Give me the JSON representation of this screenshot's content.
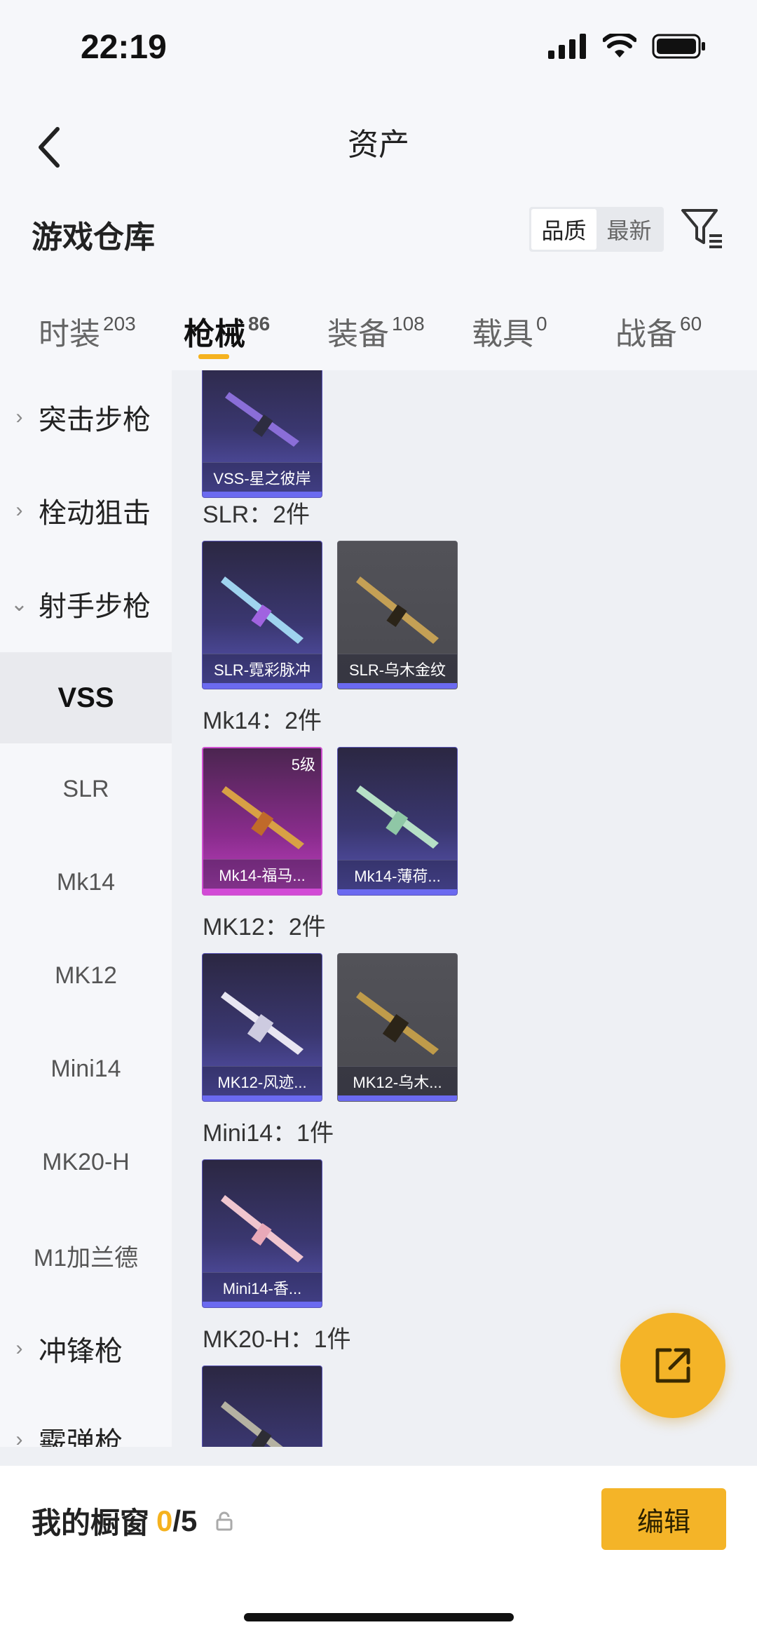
{
  "status": {
    "time": "22:19"
  },
  "nav": {
    "title": "资产"
  },
  "header": {
    "title": "游戏仓库",
    "sort_quality": "品质",
    "sort_latest": "最新"
  },
  "tabs": [
    {
      "label": "时装",
      "count": "203"
    },
    {
      "label": "枪械",
      "count": "86"
    },
    {
      "label": "装备",
      "count": "108"
    },
    {
      "label": "载具",
      "count": "0"
    },
    {
      "label": "战备",
      "count": "60"
    }
  ],
  "sidebar": {
    "cat_assault": "突击步枪",
    "cat_bolt": "栓动狙击",
    "cat_marksman": "射手步枪",
    "sub_vss": "VSS",
    "sub_slr": "SLR",
    "sub_mk14": "Mk14",
    "sub_mk12": "MK12",
    "sub_mini14": "Mini14",
    "sub_mk20h": "MK20-H",
    "sub_m1": "M1加兰德",
    "cat_smg": "冲锋枪",
    "cat_shotgun": "霰弹枪"
  },
  "groups": {
    "slr": "SLR：2件",
    "mk14": "Mk14：2件",
    "mk12": "MK12：2件",
    "mini14": "Mini14：1件",
    "mk20h": "MK20-H：1件"
  },
  "items": {
    "vss_1": "VSS-星之彼岸",
    "slr_1": "SLR-霓彩脉冲",
    "slr_2": "SLR-乌木金纹",
    "mk14_1": "Mk14-福马...",
    "mk14_1_level": "5级",
    "mk14_2": "Mk14-薄荷...",
    "mk12_1": "MK12-风迹...",
    "mk12_2": "MK12-乌木...",
    "mini14_1": "Mini14-香..."
  },
  "bottom": {
    "showcase_label": "我的橱窗",
    "showcase_count": "0",
    "showcase_total": "/5",
    "edit": "编辑"
  },
  "colors": {
    "accent": "#f4b428",
    "underline": "#f5b21f"
  }
}
